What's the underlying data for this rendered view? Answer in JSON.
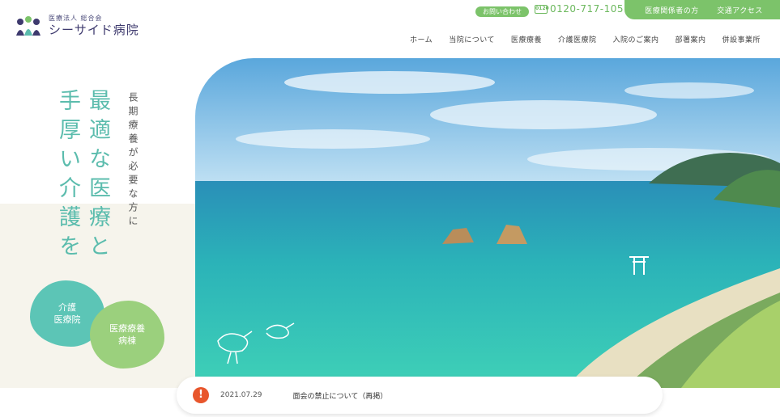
{
  "header": {
    "logo_sub": "医療法人 総合会",
    "logo_main": "シーサイド病院",
    "contact_label": "お問い合わせ",
    "phone_icon_text": "0120",
    "phone": "0120-717-105",
    "top_links": [
      "医療関係者の方",
      "交通アクセス"
    ]
  },
  "nav": {
    "items": [
      "ホーム",
      "当院について",
      "医療療養",
      "介護医療院",
      "入院のご案内",
      "部署案内",
      "併設事業所"
    ]
  },
  "hero": {
    "catch_line1": "最適な医療と",
    "catch_line2": "手厚い介護を",
    "catch_sub": "長期療養が必要な方に"
  },
  "blobs": {
    "care": "介護\n医療院",
    "medical": "医療療養\n病棟"
  },
  "news": {
    "alert": "!",
    "date": "2021.07.29",
    "title": "面会の禁止について（再掲）"
  },
  "colors": {
    "teal": "#5bbcad",
    "green": "#7cc36a",
    "navy": "#3e3a6e",
    "alert": "#e8562c"
  }
}
